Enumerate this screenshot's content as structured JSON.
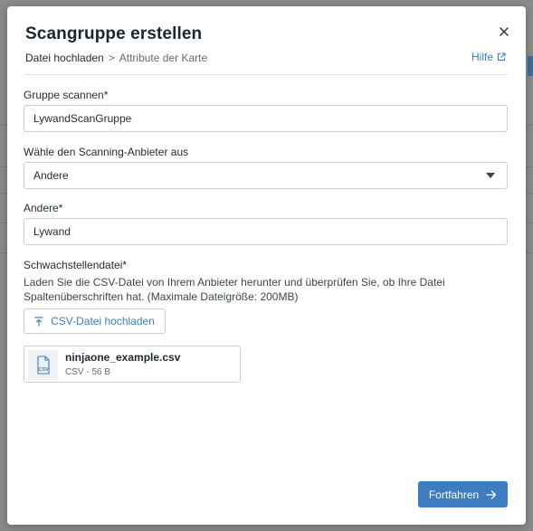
{
  "dialog": {
    "title": "Scangruppe erstellen",
    "close_icon": "close-icon",
    "breadcrumb": {
      "step1": "Datei hochladen",
      "separator": ">",
      "step2": "Attribute der Karte"
    },
    "help": {
      "label": "Hilfe",
      "icon": "external-link-icon"
    }
  },
  "form": {
    "group": {
      "label": "Gruppe scannen*",
      "value": "LywandScanGruppe"
    },
    "provider": {
      "label": "Wähle den Scanning-Anbieter aus",
      "selected": "Andere"
    },
    "other": {
      "label": "Andere*",
      "value": "Lywand"
    },
    "vuln_file": {
      "label": "Schwachstellendatei*",
      "description": "Laden Sie die CSV-Datei von Ihrem Anbieter herunter und überprüfen Sie, ob Ihre Datei Spaltenüberschriften hat. (Maximale Dateigröße: 200MB)",
      "upload_label": "CSV-Datei hochladen",
      "upload_icon": "upload-icon"
    },
    "file": {
      "name": "ninjaone_example.csv",
      "meta": "CSV - 56 B",
      "icon": "csv-file-icon"
    }
  },
  "footer": {
    "continue_label": "Fortfahren",
    "continue_icon": "arrow-right-icon"
  },
  "colors": {
    "accent": "#3d7cc1",
    "link": "#3a7fc1",
    "border": "#c9ced3"
  }
}
